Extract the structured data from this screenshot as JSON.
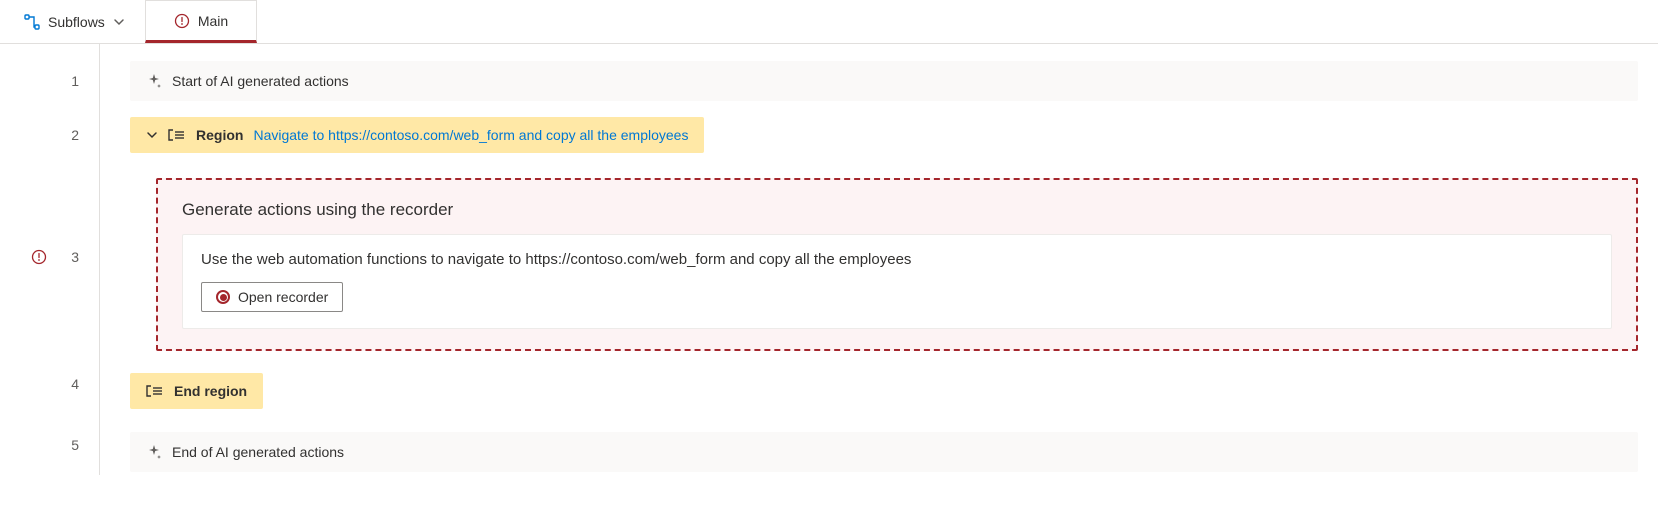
{
  "tabs": {
    "subflows_label": "Subflows",
    "main_label": "Main"
  },
  "lines": {
    "l1": "1",
    "l2": "2",
    "l3": "3",
    "l4": "4",
    "l5": "5"
  },
  "actions": {
    "start_label": "Start of AI generated actions",
    "end_label": "End of AI generated actions"
  },
  "region": {
    "title": "Region",
    "description": "Navigate to https://contoso.com/web_form and copy all the employees",
    "end_label": "End region"
  },
  "placeholder": {
    "title": "Generate actions using the recorder",
    "description": "Use the web automation functions to navigate to https://contoso.com/web_form and copy all the employees",
    "button_label": "Open recorder"
  }
}
